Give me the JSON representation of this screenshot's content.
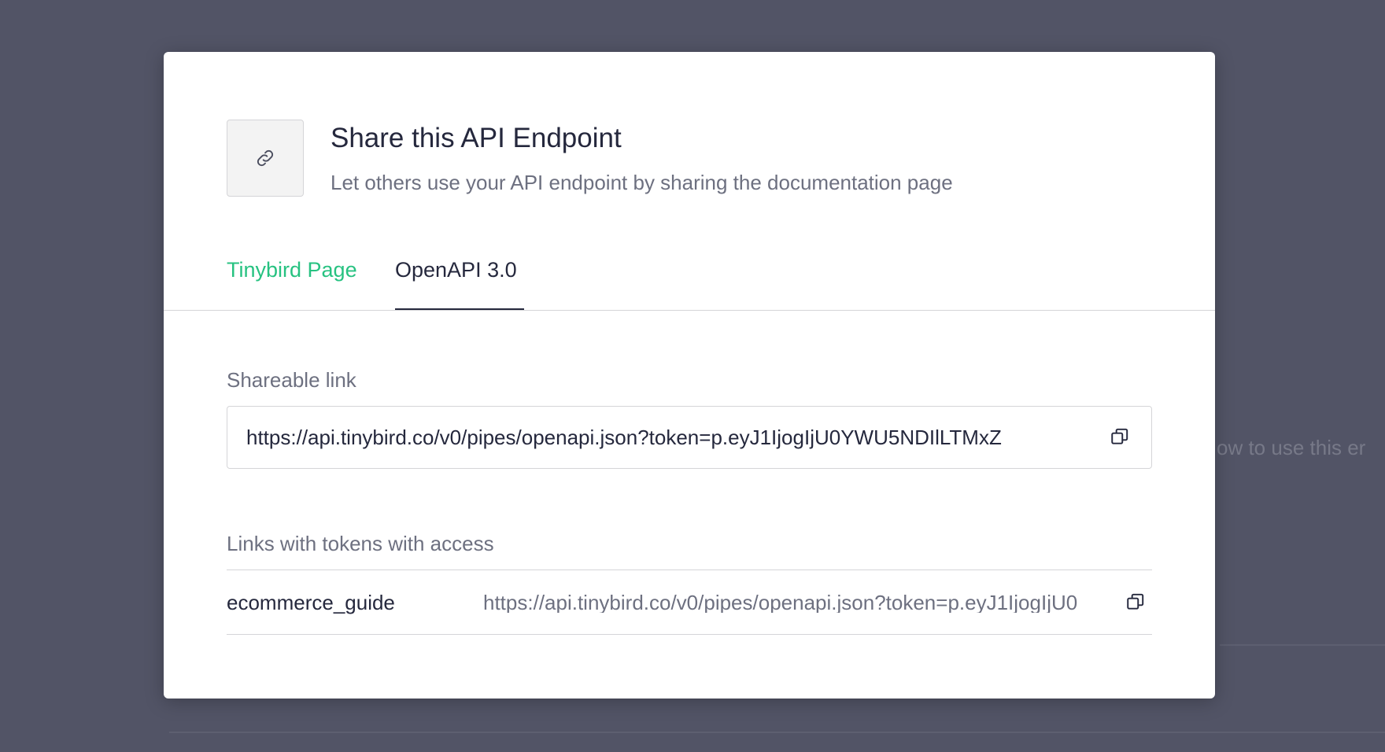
{
  "background": {
    "partial_text": "ow to use this er"
  },
  "modal": {
    "title": "Share this API Endpoint",
    "subtitle": "Let others use your API endpoint by sharing the documentation page",
    "icon": "link-icon",
    "tabs": [
      {
        "label": "Tinybird Page",
        "active": false
      },
      {
        "label": "OpenAPI 3.0",
        "active": true
      }
    ],
    "shareable": {
      "label": "Shareable link",
      "value": "https://api.tinybird.co/v0/pipes/openapi.json?token=p.eyJ1IjogIjU0YWU5NDIlLTMxZ",
      "copy_icon": "copy-icon"
    },
    "links": {
      "label": "Links with tokens with access",
      "rows": [
        {
          "name": "ecommerce_guide",
          "url": "https://api.tinybird.co/v0/pipes/openapi.json?token=p.eyJ1IjogIjU0",
          "copy_icon": "copy-icon"
        }
      ]
    }
  },
  "colors": {
    "accent": "#27c281",
    "overlay": "#525466",
    "text_primary": "#25283d",
    "text_secondary": "#6d7080",
    "border": "#d5d5d8"
  }
}
